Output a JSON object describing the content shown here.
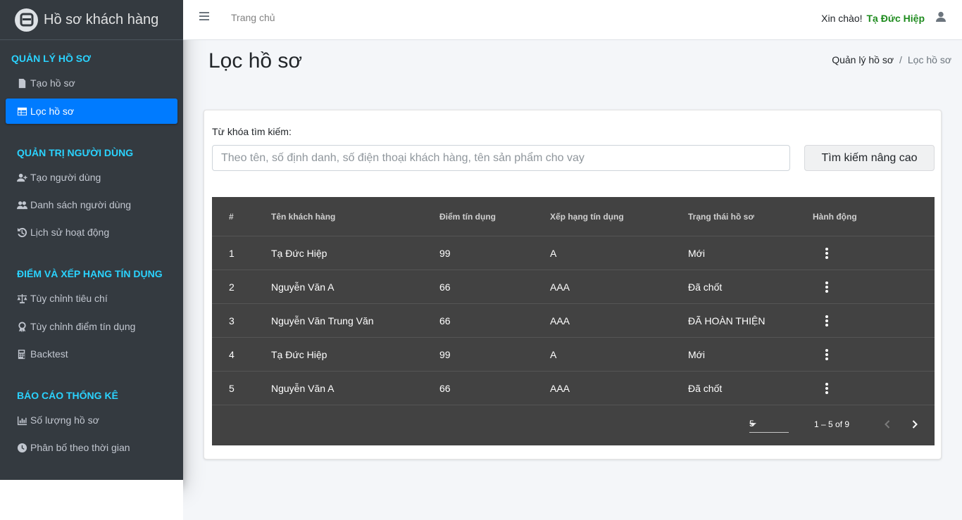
{
  "brand": {
    "title": "Hồ sơ khách hàng"
  },
  "sidebar": {
    "sections": [
      {
        "header": "QUẢN LÝ HỒ SƠ",
        "items": [
          {
            "label": "Tạo hồ sơ",
            "icon": "file-icon"
          },
          {
            "label": "Lọc hồ sơ",
            "icon": "table-icon",
            "active": true
          }
        ]
      },
      {
        "header": "QUẢN TRỊ NGƯỜI DÙNG",
        "items": [
          {
            "label": "Tạo người dùng",
            "icon": "user-plus-icon"
          },
          {
            "label": "Danh sách người dùng",
            "icon": "users-icon"
          },
          {
            "label": "Lịch sử hoạt động",
            "icon": "history-icon"
          }
        ]
      },
      {
        "header": "ĐIỂM VÀ XẾP HẠNG TÍN DỤNG",
        "items": [
          {
            "label": "Tùy chỉnh tiêu chí",
            "icon": "balance-scale-icon"
          },
          {
            "label": "Tùy chỉnh điểm tín dụng",
            "icon": "award-icon"
          },
          {
            "label": "Backtest",
            "icon": "calculator-icon"
          }
        ]
      },
      {
        "header": "BÁO CÁO THỐNG KÊ",
        "items": [
          {
            "label": "Số lượng hồ sơ",
            "icon": "chart-bar-icon"
          },
          {
            "label": "Phân bố theo thời gian",
            "icon": "clock-icon"
          }
        ]
      }
    ]
  },
  "navbar": {
    "home": "Trang chủ",
    "greeting": "Xin chào!",
    "username": "Tạ Đức Hiệp"
  },
  "page": {
    "title": "Lọc hồ sơ",
    "breadcrumb": [
      "Quản lý hồ sơ",
      "/",
      "Lọc hồ sơ"
    ]
  },
  "search": {
    "label": "Từ khóa tìm kiếm:",
    "placeholder": "Theo tên, số định danh, số điện thoại khách hàng, tên sản phẩm cho vay",
    "value": "",
    "advanced_button": "Tìm kiếm nâng cao"
  },
  "table": {
    "columns": [
      "#",
      "Tên khách hàng",
      "Điểm tín dụng",
      "Xếp hạng tín dụng",
      "Trạng thái hồ sơ",
      "Hành động"
    ],
    "rows": [
      [
        "1",
        "Tạ Đức Hiệp",
        "99",
        "A",
        "Mới"
      ],
      [
        "2",
        "Nguyễn Văn A",
        "66",
        "AAA",
        "Đã chốt"
      ],
      [
        "3",
        "Nguyễn Văn Trung Văn",
        "66",
        "AAA",
        "ĐÃ HOÀN THIỆN"
      ],
      [
        "4",
        "Tạ Đức Hiệp",
        "99",
        "A",
        "Mới"
      ],
      [
        "5",
        "Nguyễn Văn A",
        "66",
        "AAA",
        "Đã chốt"
      ]
    ],
    "page_size": "5",
    "range": "1 – 5 of 9"
  },
  "colors": {
    "sidebar_bg": "#343a40",
    "accent": "#007bff",
    "section_header": "#2ad3ff",
    "username": "#1e8b1e",
    "table_bg": "#424242"
  }
}
